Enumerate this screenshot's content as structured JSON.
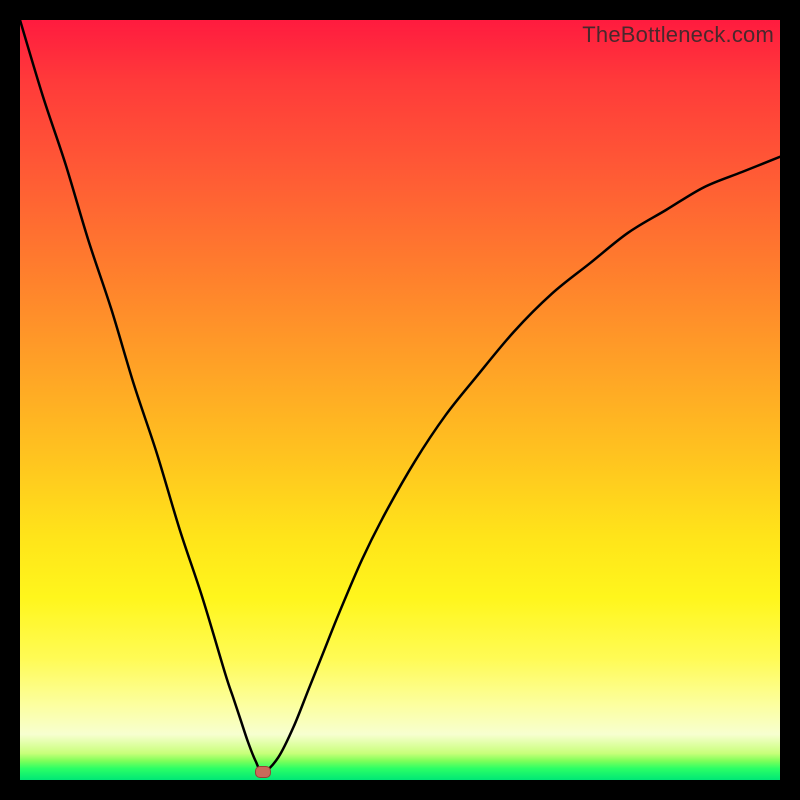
{
  "watermark": "TheBottleneck.com",
  "colors": {
    "frame": "#000000",
    "curve": "#000000",
    "marker": "#c96a5a"
  },
  "chart_data": {
    "type": "line",
    "title": "",
    "xlabel": "",
    "ylabel": "",
    "xlim": [
      0,
      100
    ],
    "ylim": [
      0,
      100
    ],
    "grid": false,
    "annotation_marker": {
      "x": 32,
      "y": 1
    },
    "series": [
      {
        "name": "bottleneck-curve",
        "x": [
          0,
          3,
          6,
          9,
          12,
          15,
          18,
          21,
          24,
          27,
          28,
          29,
          30,
          31,
          32,
          34,
          36,
          38,
          40,
          42,
          45,
          48,
          52,
          56,
          60,
          65,
          70,
          75,
          80,
          85,
          90,
          95,
          100
        ],
        "y": [
          100,
          90,
          81,
          71,
          62,
          52,
          43,
          33,
          24,
          14,
          11,
          8,
          5,
          2.5,
          1,
          3,
          7,
          12,
          17,
          22,
          29,
          35,
          42,
          48,
          53,
          59,
          64,
          68,
          72,
          75,
          78,
          80,
          82
        ]
      }
    ]
  }
}
